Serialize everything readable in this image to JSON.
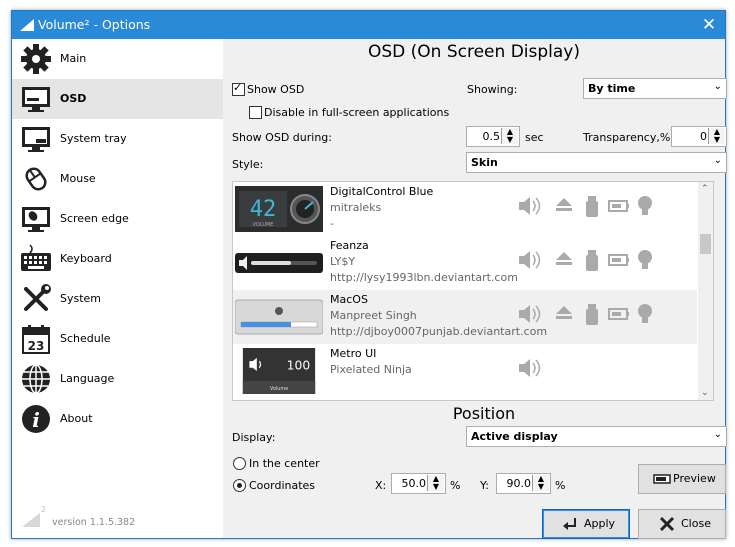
{
  "window": {
    "title": "Volume² - Options",
    "close_glyph": "✕"
  },
  "sidebar": {
    "items": [
      {
        "label": "Main",
        "icon": "gear-icon"
      },
      {
        "label": "OSD",
        "icon": "monitor-icon",
        "active": true
      },
      {
        "label": "System tray",
        "icon": "system-tray-icon"
      },
      {
        "label": "Mouse",
        "icon": "mouse-icon"
      },
      {
        "label": "Screen edge",
        "icon": "screen-edge-icon"
      },
      {
        "label": "Keyboard",
        "icon": "keyboard-icon"
      },
      {
        "label": "System",
        "icon": "tools-icon"
      },
      {
        "label": "Schedule",
        "icon": "calendar-icon",
        "calendar_day": "23"
      },
      {
        "label": "Language",
        "icon": "globe-icon"
      },
      {
        "label": "About",
        "icon": "info-icon"
      }
    ],
    "logo_sup": "2",
    "version": "version 1.1.5.382"
  },
  "osd": {
    "heading": "OSD (On Screen Display)",
    "show_osd_label": "Show OSD",
    "show_osd_checked": true,
    "fullscreen_label": "Disable in full-screen applications",
    "fullscreen_checked": false,
    "showing_label": "Showing:",
    "showing_value": "By time",
    "duration_label": "Show OSD during:",
    "duration_value": "0.5",
    "duration_unit": "sec",
    "transparency_label": "Transparency,%:",
    "transparency_value": "0",
    "style_label": "Style:",
    "style_value": "Skin"
  },
  "skins": [
    {
      "name": "DigitalControl Blue",
      "author": "mitraleks",
      "url": "-",
      "preview_text": "42",
      "preview_sub": "VOLUME"
    },
    {
      "name": "Feanza",
      "author": "LY$Y",
      "url": "http://lysy1993lbn.deviantart.com"
    },
    {
      "name": "MacOS",
      "author": "Manpreet Singh",
      "url": "http://djboy0007punjab.deviantart.com"
    },
    {
      "name": "Metro UI",
      "author": "Pixelated Ninja",
      "url": "",
      "preview_text": "100",
      "preview_sub": "Volume"
    }
  ],
  "position": {
    "heading": "Position",
    "display_label": "Display:",
    "display_value": "Active display",
    "center_label": "In the center",
    "center_selected": false,
    "coords_label": "Coordinates",
    "coords_selected": true,
    "x_label": "X:",
    "x_value": "50.0",
    "x_unit": "%",
    "y_label": "Y:",
    "y_value": "90.0",
    "y_unit": "%",
    "preview_label": "Preview"
  },
  "buttons": {
    "apply": "Apply",
    "close": "Close"
  },
  "colors": {
    "titlebar": "#2a8ad8",
    "active_nav": "#e5e5e5",
    "panel": "#f0f0f0",
    "skin_accent": "#3fb8d8"
  }
}
